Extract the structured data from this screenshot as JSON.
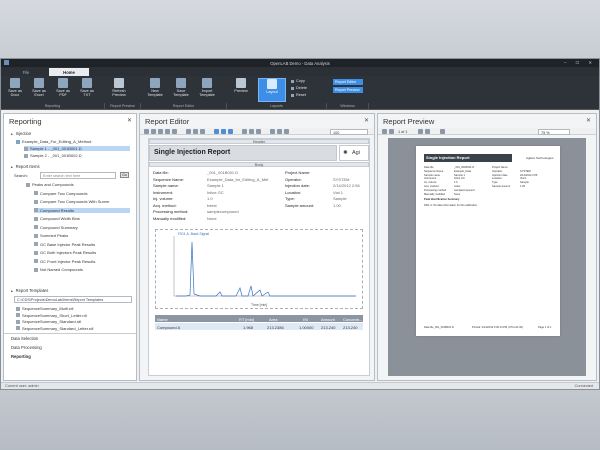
{
  "app": {
    "title": "OpenLAB Demo - Data Analysis",
    "window_controls": "–  ☐  ✕"
  },
  "tabs": [
    "File",
    "Home"
  ],
  "ribbon": {
    "buttons": [
      "Save as Docx",
      "Save as Excel",
      "Save as PDF",
      "Save as TXT",
      "Refresh Preview",
      "New Template",
      "Save Template",
      "Import Template",
      "Preview",
      "Layout"
    ],
    "small": [
      "Copy",
      "Delete",
      "Reset"
    ],
    "windows": [
      "Report Editor",
      "Report Preview"
    ],
    "groups": [
      "Reporting",
      "Report Preview",
      "Report Editor",
      "Layouts",
      "Windows"
    ]
  },
  "left": {
    "title": "Reporting",
    "injection_label": "Injection",
    "injection_items": [
      "Example_Data_For_Editing_A_Method",
      "Sample 1 - _001_001B001.D",
      "Sample 2 - _001_001B002.D"
    ],
    "report_items_label": "Report Items",
    "search_label": "Search:",
    "search_placeholder": "Enter search text here",
    "go": "Go",
    "report_items": [
      "Peaks and Compounds",
      "Compare Two Compounds",
      "Compare Two Compounds With Summ",
      "Compound Results",
      "Compound Width Bins",
      "Compound Summary",
      "Summed Peaks",
      "GC Base Injector Peak Results",
      "GC Both Injectors Peak Results",
      "GC Front Injector Peak Results",
      "Not Named Compounds"
    ],
    "templates_label": "Report Templates",
    "template_path": "C:\\CDS\\Projects\\DemoLab\\Items\\Report Templates",
    "templates": [
      "SequenceSummary_Multi.rdl",
      "SequenceSummary_Short_Letter.rdl",
      "SequenceSummary_Standard.rdl",
      "SequenceSummary_Standard_Letter.rdl"
    ],
    "nav": [
      "Data Selection",
      "Data Processing",
      "Reporting"
    ]
  },
  "editor": {
    "title": "Report Editor",
    "zoom": "100",
    "header_band": "Header",
    "body_band": "Body",
    "report_title": "Single Injection Report",
    "logo_text": "Agi",
    "fields_left": [
      [
        "Data file:",
        "_001_001B001.D"
      ],
      [
        "Sequence Name:",
        "Example_Data_for_Editing_A_Met"
      ],
      [
        "Sample name:",
        "Sample 1"
      ],
      [
        "Instrument:",
        "Inline GC"
      ],
      [
        "Inj. volume:",
        "1.0"
      ],
      [
        "Acq. method:",
        "tvtest"
      ],
      [
        "Processing method:",
        "samplecompound"
      ],
      [
        "Manually modified:",
        "None"
      ]
    ],
    "fields_right": [
      [
        "Project Name:",
        ""
      ],
      [
        "Operator:",
        "SYSTEM"
      ],
      [
        "Injection date:",
        "2/14/2012 2:56"
      ],
      [
        "Location:",
        "Vial 1"
      ],
      [
        "Type:",
        "Sample"
      ],
      [
        "Sample amount:",
        "1.00"
      ]
    ],
    "chart_label": "FID1 A, Back Signal",
    "chart_xlabel": "Time [min]",
    "table_headers": [
      "Name",
      "RT [min]",
      "Area",
      "ISt",
      "Amount",
      "Concentr..."
    ],
    "table_row": [
      "Compound A",
      "1.968",
      "213.2386",
      "1.00000",
      "213.240",
      "213.240"
    ]
  },
  "preview": {
    "title": "Report Preview",
    "page_info": "1 of 1",
    "zoom": "75 %",
    "report_title": "Single Injection Report",
    "logo": "Agilent Technologies",
    "lines_left": [
      "Data file",
      "Sequence Name",
      "Sample name",
      "Instrument",
      "Inj. volume",
      "Acq. method",
      "Processing method",
      "Manually modified"
    ],
    "lines_mid": [
      "_001_001B001.D",
      "Example_Data",
      "Sample 1",
      "Inline GC",
      "1.0",
      "tvtest",
      "samplecompound",
      "None"
    ],
    "lines_right": [
      "Project Name",
      "Operator",
      "Injection date",
      "Location",
      "Type",
      "Sample amount"
    ],
    "lines_right_vals": [
      "",
      "SYSTEM",
      "2/14/2012 2:56",
      "Vial 1",
      "Sample",
      "1.00"
    ],
    "note1": "Peak Identification Summary",
    "note2": "FID1 A: No data information for this calibration.",
    "footer_left": "Data file_001_001B001.D",
    "footer_mid": "Printed: 2/14/2012 5:00:14 PM (UTC+01:00)",
    "footer_right": "Page 1 of 1"
  },
  "status": {
    "left": "Current user: admin",
    "right": "Connected"
  }
}
